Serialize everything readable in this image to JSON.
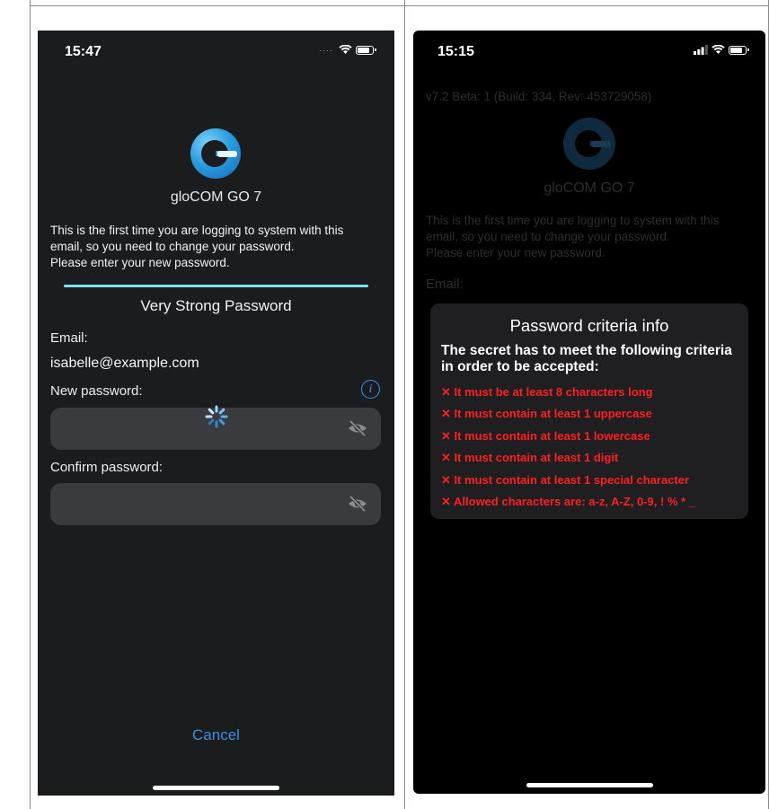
{
  "left_screen": {
    "status_time": "15:47",
    "app_name": "gloCOM GO 7",
    "intro_lines": [
      "This is the first time you are logging to system with this",
      "email, so you need to change your password.",
      "Please enter your new password."
    ],
    "strength_label": "Very Strong Password",
    "email_label": "Email:",
    "email_value": "isabelle@example.com",
    "new_password_label": "New password:",
    "info_glyph": "i",
    "confirm_password_label": "Confirm password:",
    "cancel_label": "Cancel",
    "icons": [
      "wifi-icon",
      "battery-icon",
      "info-icon",
      "eye-slash-icon",
      "loading-spinner-icon"
    ]
  },
  "right_screen": {
    "status_time": "15:15",
    "version": "v7.2 Beta: 1 (Build: 334, Rev: 453729058)",
    "app_name": "gloCOM GO 7",
    "intro_lines": [
      "This is the first time you are logging to system with this",
      "email, so you need to change your password.",
      "Please enter your new password."
    ],
    "email_label": "Email:",
    "modal": {
      "title": "Password criteria info",
      "subtitle": "The secret has to meet the following criteria in order to be accepted:",
      "criteria": [
        "✕ It must be at least 8  characters long",
        "✕ It must contain at least 1 uppercase",
        "✕ It must contain at least 1 lowercase",
        "✕ It must contain at least 1 digit",
        "✕ It must contain at least 1 special character",
        "✕ Allowed characters are: a-z, A-Z, 0-9, ! % * _"
      ]
    }
  },
  "colors": {
    "accent_blue": "#3a8fe0",
    "strength_bar": "#79e3f0",
    "error_red": "#ff1f1f",
    "left_bg": "#1b1c1e",
    "right_bg": "#000000"
  }
}
